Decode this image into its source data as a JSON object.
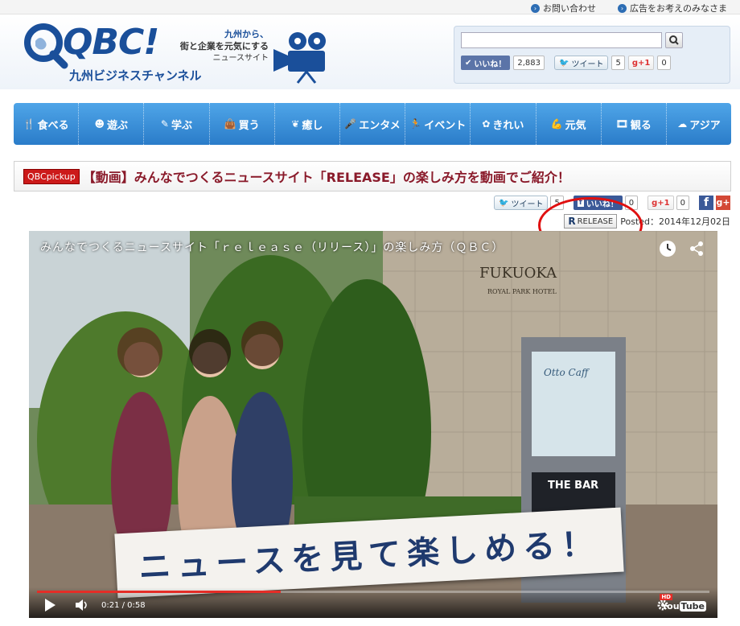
{
  "util": {
    "contact": "お問い合わせ",
    "advertise": "広告をお考えのみなさま"
  },
  "logo": {
    "main": "QBC!",
    "sub": "九州ビジネスチャンネル",
    "tagline_1": "九州から、",
    "tagline_2": "街と企業を元気にする",
    "tagline_3": "ニュースサイト"
  },
  "header_social": {
    "like_label": "いいね！",
    "like_count": "2,883",
    "tweet_label": "ツイート",
    "tweet_count": "5",
    "gplus_label": "g+1",
    "gplus_count": "0"
  },
  "nav": [
    {
      "icon": "🍴",
      "label": "食べる",
      "name": "nav-eat"
    },
    {
      "icon": "☻",
      "label": "遊ぶ",
      "name": "nav-play"
    },
    {
      "icon": "✎",
      "label": "学ぶ",
      "name": "nav-learn"
    },
    {
      "icon": "👜",
      "label": "買う",
      "name": "nav-buy"
    },
    {
      "icon": "❦",
      "label": "癒し",
      "name": "nav-relax"
    },
    {
      "icon": "🎤",
      "label": "エンタメ",
      "name": "nav-entertain"
    },
    {
      "icon": "🏃",
      "label": "イベント",
      "name": "nav-event"
    },
    {
      "icon": "✿",
      "label": "きれい",
      "name": "nav-beauty"
    },
    {
      "icon": "💪",
      "label": "元気",
      "name": "nav-energy"
    },
    {
      "icon": "🎞",
      "label": "観る",
      "name": "nav-watch"
    },
    {
      "icon": "☁",
      "label": "アジア",
      "name": "nav-asia"
    }
  ],
  "article": {
    "badge": "QBCpickup",
    "title": "【動画】みんなでつくるニュースサイト「RELEASE」の楽しみ方を動画でご紹介！",
    "tweet_label": "ツイート",
    "tweet_count": "5",
    "like_label": "いいね！",
    "like_count": "0",
    "gplus_label": "g+1",
    "gplus_count": "0",
    "release_label": "RELEASE",
    "posted": "Posted：2014年12月02日"
  },
  "video": {
    "title": "みんなでつくるニュースサイト「ｒｅｌｅａｓｅ（リリース）」の楽しみ方（ＱＢＣ）",
    "banner": "ニュースを見て楽しめる！",
    "sign_1": "FUKUOKA",
    "sign_2": "ROYAL PARK HOTEL",
    "sign_bar": "THE BAR",
    "sign_cafe": "Otto Caff",
    "time": "0:21 / 0:58",
    "progress": 0.362,
    "hd": "HD",
    "yt_you": "You",
    "yt_tube": "Tube"
  },
  "colors": {
    "brand_blue": "#1a4f9a",
    "nav_top": "#4fa5e8",
    "nav_bottom": "#2a7cc9",
    "title_red": "#8a1a2a",
    "badge_red": "#cc1a1a",
    "annotation": "#e01010",
    "yt_red": "#e52d27"
  }
}
